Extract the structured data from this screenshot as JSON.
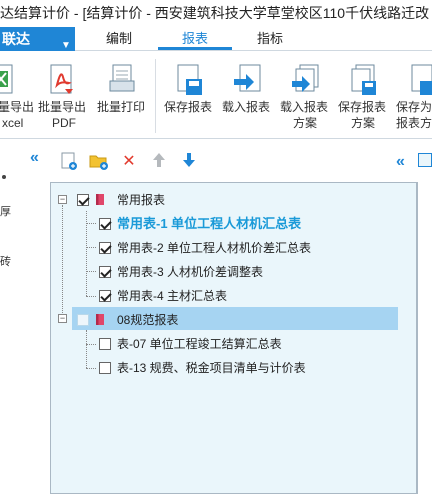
{
  "window": {
    "title": "达结算计价 - [结算计价 - 西安建筑科技大学草堂校区110千伏线路迁改"
  },
  "menubar": {
    "brand": "联达",
    "tabs": [
      {
        "label": "编制",
        "active": false
      },
      {
        "label": "报表",
        "active": true
      },
      {
        "label": "指标",
        "active": false
      }
    ]
  },
  "ribbon": {
    "buttons": [
      {
        "line1": "量导出",
        "line2": "xcel",
        "icon": "excel-export-icon"
      },
      {
        "line1": "批量导出",
        "line2": "PDF",
        "icon": "pdf-export-icon"
      },
      {
        "line1": "批量打印",
        "line2": "",
        "icon": "print-icon"
      },
      {
        "line1": "保存报表",
        "line2": "",
        "icon": "save-report-icon"
      },
      {
        "line1": "载入报表",
        "line2": "",
        "icon": "load-report-icon"
      },
      {
        "line1": "载入报表",
        "line2": "方案",
        "icon": "load-scheme-icon"
      },
      {
        "line1": "保存报表",
        "line2": "方案",
        "icon": "save-scheme-icon"
      },
      {
        "line1": "保存为",
        "line2": "报表方",
        "icon": "save-as-icon"
      }
    ]
  },
  "left_strip": {
    "glyph1": "厚",
    "glyph2": "砖",
    "collapse": "«"
  },
  "toolbar": {
    "collapse": "«"
  },
  "tree": {
    "groups": [
      {
        "label": "常用报表",
        "checked": true,
        "expander": "−",
        "items": [
          {
            "label": "常用表-1  单位工程人材机汇总表",
            "checked": true,
            "bold": true
          },
          {
            "label": "常用表-2  单位工程人材机价差汇总表",
            "checked": true,
            "bold": false
          },
          {
            "label": "常用表-3  人材机价差调整表",
            "checked": true,
            "bold": false
          },
          {
            "label": "常用表-4  主材汇总表",
            "checked": true,
            "bold": false
          }
        ]
      },
      {
        "label": "08规范报表",
        "checked": false,
        "expander": "−",
        "items": [
          {
            "label": "表-07  单位工程竣工结算汇总表",
            "checked": false,
            "bold": false
          },
          {
            "label": "表-13  规费、税金项目清单与计价表",
            "checked": false,
            "bold": false
          }
        ]
      }
    ]
  },
  "colors": {
    "accent": "#1f86d6",
    "selection": "#a6d4f2",
    "panel": "#eaf6fb",
    "bold_text": "#1a9ad8"
  }
}
